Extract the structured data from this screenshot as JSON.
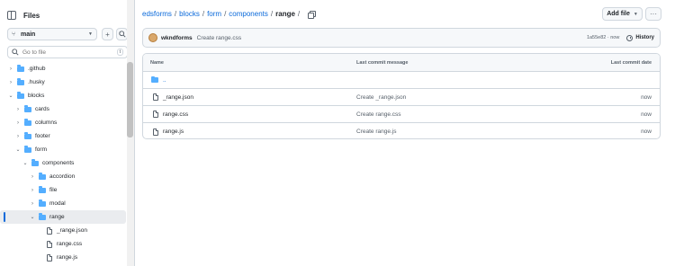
{
  "sidebar": {
    "title": "Files",
    "branch": "main",
    "search_placeholder": "Go to file",
    "search_kbd": "t",
    "tree": [
      {
        "label": ".github",
        "type": "folder",
        "expanded": false,
        "depth": 0
      },
      {
        "label": ".husky",
        "type": "folder",
        "expanded": false,
        "depth": 0
      },
      {
        "label": "blocks",
        "type": "folder",
        "expanded": true,
        "depth": 0
      },
      {
        "label": "cards",
        "type": "folder",
        "expanded": false,
        "depth": 1
      },
      {
        "label": "columns",
        "type": "folder",
        "expanded": false,
        "depth": 1
      },
      {
        "label": "footer",
        "type": "folder",
        "expanded": false,
        "depth": 1
      },
      {
        "label": "form",
        "type": "folder",
        "expanded": true,
        "depth": 1
      },
      {
        "label": "components",
        "type": "folder",
        "expanded": true,
        "depth": 2
      },
      {
        "label": "accordion",
        "type": "folder",
        "expanded": false,
        "depth": 3
      },
      {
        "label": "file",
        "type": "folder",
        "expanded": false,
        "depth": 3
      },
      {
        "label": "modal",
        "type": "folder",
        "expanded": false,
        "depth": 3
      },
      {
        "label": "range",
        "type": "folder",
        "expanded": true,
        "depth": 3,
        "active": true
      },
      {
        "label": "_range.json",
        "type": "file",
        "depth": 4
      },
      {
        "label": "range.css",
        "type": "file",
        "depth": 4
      },
      {
        "label": "range.js",
        "type": "file",
        "depth": 4
      }
    ]
  },
  "breadcrumb": {
    "parts": [
      "edsforms",
      "blocks",
      "form",
      "components"
    ],
    "current": "range",
    "trailing": "/"
  },
  "header": {
    "add_file": "Add file",
    "more": "···"
  },
  "commit": {
    "author": "wkndforms",
    "message": "Create range.css",
    "hash_time": "1a55e82 · now",
    "history": "History"
  },
  "table": {
    "headers": {
      "name": "Name",
      "message": "Last commit message",
      "date": "Last commit date"
    },
    "parent": "..",
    "rows": [
      {
        "name": "_range.json",
        "message": "Create _range.json",
        "date": "now"
      },
      {
        "name": "range.css",
        "message": "Create range.css",
        "date": "now"
      },
      {
        "name": "range.js",
        "message": "Create range.js",
        "date": "now"
      }
    ]
  },
  "colors": {
    "link": "#0969da",
    "folder": "#54aeff",
    "border": "#d0d7de",
    "muted": "#57606a"
  }
}
